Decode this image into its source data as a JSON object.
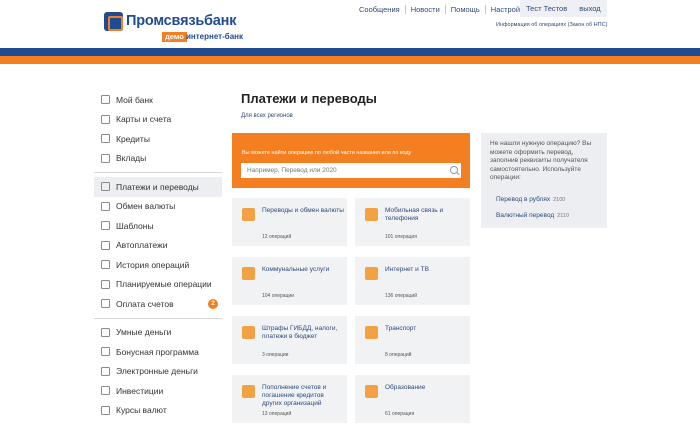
{
  "brand": {
    "name": "Промсвязьбанк",
    "demo_badge": "демо",
    "sub": "интернет-банк"
  },
  "topnav": {
    "items": [
      "Сообщения",
      "Новости",
      "Помощь",
      "Настройки"
    ],
    "user_name": "Тест Тестов",
    "logout": "выход",
    "info_link": "Информация об операциях (Закон об НПС)"
  },
  "sidebar": {
    "items": [
      {
        "label": "Мой банк",
        "icon": "home-icon"
      },
      {
        "label": "Карты и счета",
        "icon": "card-icon"
      },
      {
        "label": "Кредиты",
        "icon": "credit-icon"
      },
      {
        "label": "Вклады",
        "icon": "chart-icon"
      },
      {
        "label": "Платежи и переводы",
        "icon": "transfer-icon",
        "active": true
      },
      {
        "label": "Обмен валюты",
        "icon": "exchange-icon"
      },
      {
        "label": "Шаблоны",
        "icon": "star-icon"
      },
      {
        "label": "Автоплатежи",
        "icon": "alarm-icon"
      },
      {
        "label": "История операций",
        "icon": "history-icon"
      },
      {
        "label": "Планируемые операции",
        "icon": "calendar-icon"
      },
      {
        "label": "Оплата счетов",
        "icon": "bill-icon",
        "badge": "2"
      },
      {
        "label": "Умные деньги",
        "icon": "clock-icon"
      },
      {
        "label": "Бонусная программа",
        "icon": "bonus-icon"
      },
      {
        "label": "Электронные деньги",
        "icon": "wallet-icon"
      },
      {
        "label": "Инвестиции",
        "icon": "investment-icon"
      },
      {
        "label": "Курсы валют",
        "icon": "rates-icon"
      }
    ]
  },
  "main": {
    "title": "Платежи и переводы",
    "regions_link": "Для всех регионов",
    "search": {
      "hint": "Вы можете найти операцию по любой части названия или по коду",
      "placeholder": "Например, Перевод или 2020"
    },
    "cards": [
      {
        "title": "Переводы и обмен валюты",
        "count": "12 операций",
        "icon": "transfer-icon"
      },
      {
        "title": "Мобильная связь и телефония",
        "count": "101 операция",
        "icon": "mobile-icon"
      },
      {
        "title": "Коммунальные услуги",
        "count": "104 операции",
        "icon": "utilities-icon"
      },
      {
        "title": "Интернет и ТВ",
        "count": "136 операций",
        "icon": "tv-icon"
      },
      {
        "title": "Штрафы ГИБДД, налоги, платежи в бюджет",
        "count": "3 операции",
        "icon": "gavel-icon"
      },
      {
        "title": "Транспорт",
        "count": "8 операций",
        "icon": "bus-icon"
      },
      {
        "title": "Пополнение счетов и погашение кредитов других организаций",
        "count": "13 операций",
        "icon": "coins-icon"
      },
      {
        "title": "Образование",
        "count": "61 операция",
        "icon": "education-icon"
      }
    ]
  },
  "help_panel": {
    "text": "Не нашли нужную операцию? Вы можете оформить перевод, заполнив реквизиты получателя самостоятельно. Используйте операции:",
    "links": [
      {
        "label": "Перевод в рублях",
        "code": "2100"
      },
      {
        "label": "Валютный перевод",
        "code": "2110"
      }
    ]
  },
  "colors": {
    "brand_blue": "#1f4b91",
    "brand_orange": "#f47f20",
    "card_bg": "#f1f2f4"
  }
}
